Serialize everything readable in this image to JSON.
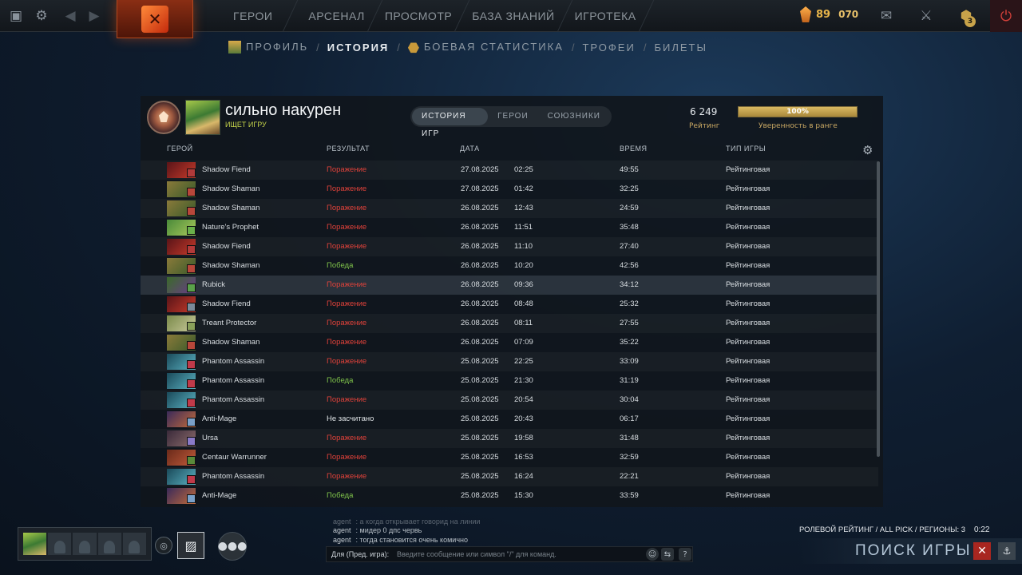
{
  "topbar": {
    "nav": [
      "ГЕРОИ",
      "АРСЕНАЛ",
      "ПРОСМОТР",
      "БАЗА ЗНАНИЙ",
      "ИГРОТЕКА"
    ],
    "currency_a": "89",
    "currency_b": "070",
    "notifications_badge": "3",
    "accent": "#c8993a"
  },
  "subnav": {
    "profile": "ПРОФИЛЬ",
    "history": "ИСТОРИЯ",
    "stats": "БОЕВАЯ СТАТИСТИКА",
    "trophies": "ТРОФЕИ",
    "tickets": "БИЛЕТЫ",
    "sep": "/"
  },
  "player": {
    "name": "сильно накурен",
    "status": "ИЩЕТ ИГРУ"
  },
  "tabs": {
    "games": "ИСТОРИЯ ИГР",
    "heroes": "ГЕРОИ",
    "allies": "СОЮЗНИКИ"
  },
  "rating": {
    "value": "6 249",
    "label": "Рейтинг",
    "confidence_pct": "100%",
    "confidence_fraction": 1.0,
    "confidence_label": "Уверенность в ранге"
  },
  "table": {
    "headers": {
      "hero": "ГЕРОЙ",
      "result": "РЕЗУЛЬТАТ",
      "date": "ДАТА",
      "duration": "ВРЕМЯ",
      "type": "ТИП ИГРЫ"
    },
    "rows": [
      {
        "hero": "Shadow Fiend",
        "result": "Поражение",
        "kind": "loss",
        "date": "27.08.2025",
        "time": "02:25",
        "duration": "49:55",
        "type": "Рейтинговая",
        "c1": "#5a1418",
        "c2": "#c53a2a",
        "badge": "#b23a3a"
      },
      {
        "hero": "Shadow Shaman",
        "result": "Поражение",
        "kind": "loss",
        "date": "27.08.2025",
        "time": "01:42",
        "duration": "32:25",
        "type": "Рейтинговая",
        "c1": "#8a7a3a",
        "c2": "#3a5a2a",
        "badge": "#b8473a"
      },
      {
        "hero": "Shadow Shaman",
        "result": "Поражение",
        "kind": "loss",
        "date": "26.08.2025",
        "time": "12:43",
        "duration": "24:59",
        "type": "Рейтинговая",
        "c1": "#8a7a3a",
        "c2": "#3a5a2a",
        "badge": "#b8473a"
      },
      {
        "hero": "Nature's Prophet",
        "result": "Поражение",
        "kind": "loss",
        "date": "26.08.2025",
        "time": "11:51",
        "duration": "35:48",
        "type": "Рейтинговая",
        "c1": "#4a8a3a",
        "c2": "#a8c85a",
        "badge": "#6ab04a"
      },
      {
        "hero": "Shadow Fiend",
        "result": "Поражение",
        "kind": "loss",
        "date": "26.08.2025",
        "time": "11:10",
        "duration": "27:40",
        "type": "Рейтинговая",
        "c1": "#5a1418",
        "c2": "#c53a2a",
        "badge": "#b23a3a"
      },
      {
        "hero": "Shadow Shaman",
        "result": "Победа",
        "kind": "win",
        "date": "26.08.2025",
        "time": "10:20",
        "duration": "42:56",
        "type": "Рейтинговая",
        "c1": "#8a7a3a",
        "c2": "#3a5a2a",
        "badge": "#b8473a"
      },
      {
        "hero": "Rubick",
        "result": "Поражение",
        "kind": "loss",
        "date": "26.08.2025",
        "time": "09:36",
        "duration": "34:12",
        "type": "Рейтинговая",
        "c1": "#3a6a2a",
        "c2": "#6a3a8a",
        "badge": "#5aa04a",
        "highlight": true
      },
      {
        "hero": "Shadow Fiend",
        "result": "Поражение",
        "kind": "loss",
        "date": "26.08.2025",
        "time": "08:48",
        "duration": "25:32",
        "type": "Рейтинговая",
        "c1": "#5a1418",
        "c2": "#c53a2a",
        "badge": "#7a8a9a"
      },
      {
        "hero": "Treant Protector",
        "result": "Поражение",
        "kind": "loss",
        "date": "26.08.2025",
        "time": "08:11",
        "duration": "27:55",
        "type": "Рейтинговая",
        "c1": "#7a8a4a",
        "c2": "#c8c89a",
        "badge": "#8aa05a"
      },
      {
        "hero": "Shadow Shaman",
        "result": "Поражение",
        "kind": "loss",
        "date": "26.08.2025",
        "time": "07:09",
        "duration": "35:22",
        "type": "Рейтинговая",
        "c1": "#8a7a3a",
        "c2": "#3a5a2a",
        "badge": "#b8473a"
      },
      {
        "hero": "Phantom Assassin",
        "result": "Поражение",
        "kind": "loss",
        "date": "25.08.2025",
        "time": "22:25",
        "duration": "33:09",
        "type": "Рейтинговая",
        "c1": "#1a4a5a",
        "c2": "#5ab0c0",
        "badge": "#c03a4a"
      },
      {
        "hero": "Phantom Assassin",
        "result": "Победа",
        "kind": "win",
        "date": "25.08.2025",
        "time": "21:30",
        "duration": "31:19",
        "type": "Рейтинговая",
        "c1": "#1a4a5a",
        "c2": "#5ab0c0",
        "badge": "#c03a4a"
      },
      {
        "hero": "Phantom Assassin",
        "result": "Поражение",
        "kind": "loss",
        "date": "25.08.2025",
        "time": "20:54",
        "duration": "30:04",
        "type": "Рейтинговая",
        "c1": "#1a4a5a",
        "c2": "#5ab0c0",
        "badge": "#c03a4a"
      },
      {
        "hero": "Anti-Mage",
        "result": "Не засчитано",
        "kind": "void",
        "date": "25.08.2025",
        "time": "20:43",
        "duration": "06:17",
        "type": "Рейтинговая",
        "c1": "#3a2a5a",
        "c2": "#c06a3a",
        "badge": "#7aa0c8"
      },
      {
        "hero": "Ursa",
        "result": "Поражение",
        "kind": "loss",
        "date": "25.08.2025",
        "time": "19:58",
        "duration": "31:48",
        "type": "Рейтинговая",
        "c1": "#3a2a3a",
        "c2": "#8a6a6a",
        "badge": "#8a7ac8"
      },
      {
        "hero": "Centaur Warrunner",
        "result": "Поражение",
        "kind": "loss",
        "date": "25.08.2025",
        "time": "16:53",
        "duration": "32:59",
        "type": "Рейтинговая",
        "c1": "#6a2a1a",
        "c2": "#c05a3a",
        "badge": "#5a8a3a"
      },
      {
        "hero": "Phantom Assassin",
        "result": "Поражение",
        "kind": "loss",
        "date": "25.08.2025",
        "time": "16:24",
        "duration": "22:21",
        "type": "Рейтинговая",
        "c1": "#1a4a5a",
        "c2": "#5ab0c0",
        "badge": "#c03a4a"
      },
      {
        "hero": "Anti-Mage",
        "result": "Победа",
        "kind": "win",
        "date": "25.08.2025",
        "time": "15:30",
        "duration": "33:59",
        "type": "Рейтинговая",
        "c1": "#3a2a5a",
        "c2": "#c06a3a",
        "badge": "#7aa0c8"
      }
    ]
  },
  "chat": {
    "lines": [
      {
        "who": "agent",
        "text": ": а когда открывает          говорид на линии"
      },
      {
        "who": "agent",
        "text": ": мидер 0 дпс червь"
      },
      {
        "who": "agent",
        "text": ": тогда становится очень комично"
      }
    ],
    "prefix": "Для (Пред. игра):",
    "placeholder": "Введите сообщение или символ \"/\" для команд."
  },
  "matchmaking": {
    "info": "РОЛЕВОЙ РЕЙТИНГ / ALL PICK / РЕГИОНЫ: 3",
    "timer": "0:22",
    "find_label": "ПОИСК ИГРЫ"
  }
}
